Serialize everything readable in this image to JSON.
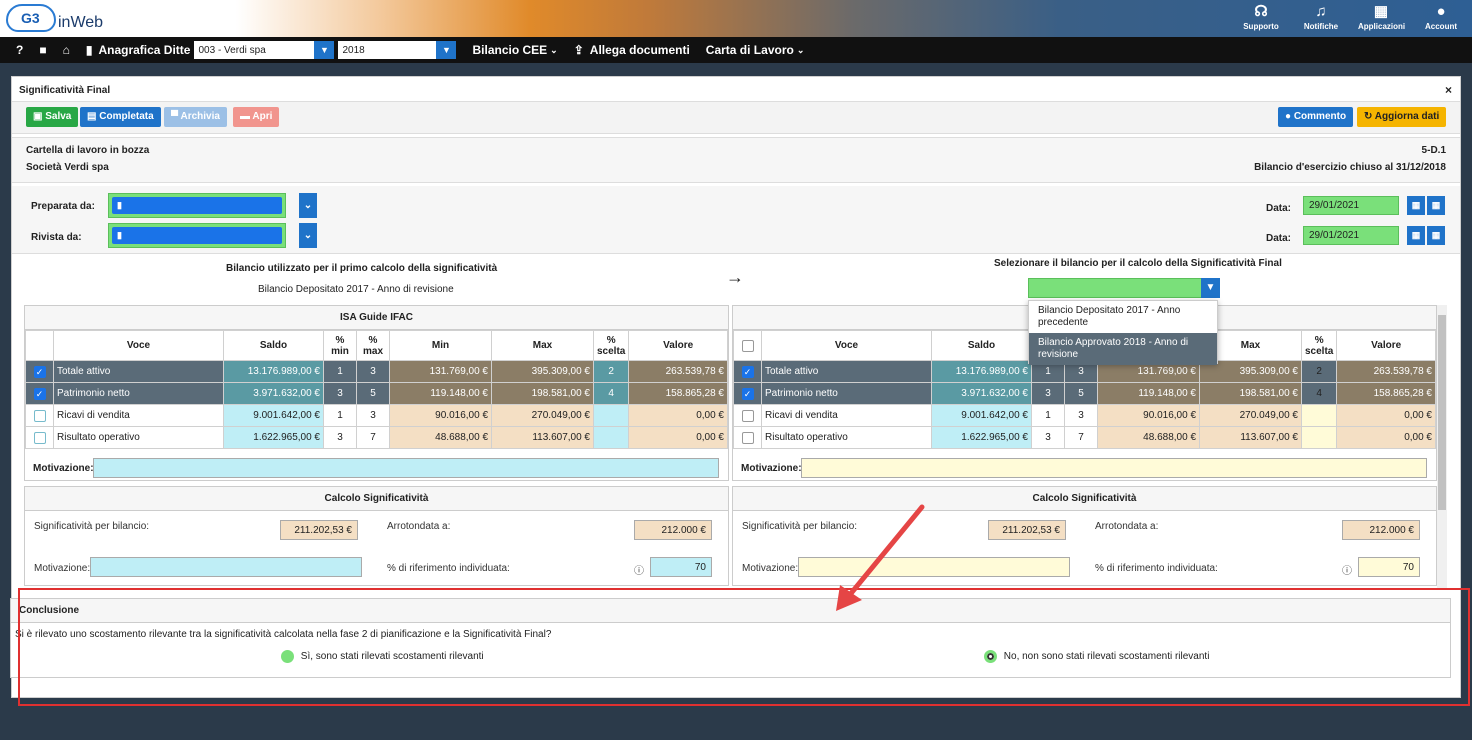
{
  "app": {
    "logo": "inWeb",
    "logo_mark": "G3"
  },
  "topbar": {
    "items": [
      {
        "label": "Supporto",
        "icon": "headset-icon",
        "glyph": "☊"
      },
      {
        "label": "Notifiche",
        "icon": "bell-icon",
        "glyph": "♫"
      },
      {
        "label": "Applicazioni",
        "icon": "grid-icon",
        "glyph": "▦"
      },
      {
        "label": "Account",
        "icon": "account-icon",
        "glyph": "●"
      }
    ]
  },
  "nav": {
    "help": "?",
    "anagrafica": "Anagrafica Ditte",
    "company": "003 - Verdi spa",
    "year": "2018",
    "bilancio": "Bilancio CEE",
    "allega": "Allega documenti",
    "carta": "Carta di Lavoro"
  },
  "panel": {
    "title": "Significatività Final",
    "close": "×"
  },
  "toolbar": {
    "salva": "Salva",
    "completata": "Completata",
    "archivia": "Archivia",
    "apri": "Apri",
    "commento": "Commento",
    "aggiorna": "Aggiorna dati"
  },
  "info": {
    "status": "Cartella di lavoro in bozza",
    "company": "Società Verdi spa",
    "code": "5-D.1",
    "bilancio": "Bilancio d'esercizio chiuso al 31/12/2018"
  },
  "prep": {
    "preparata": "Preparata da:",
    "rivista": "Rivista da:",
    "data_label": "Data:",
    "data1": "29/01/2021",
    "data2": "29/01/2021"
  },
  "left": {
    "heading": "Bilancio utilizzato per il primo calcolo della significatività",
    "sub": "Bilancio Depositato 2017  - Anno di revisione",
    "table_title": "ISA Guide IFAC"
  },
  "right": {
    "heading": "Selezionare il bilancio per il calcolo della Significatività Final",
    "options": [
      "Bilancio Depositato 2017 - Anno precedente",
      "Bilancio Approvato 2018 - Anno di revisione"
    ]
  },
  "cols": {
    "voce": "Voce",
    "saldo": "Saldo",
    "pmin": "% min",
    "pmax": "% max",
    "min": "Min",
    "max": "Max",
    "pscelta": "% scelta",
    "valore": "Valore"
  },
  "rows": [
    {
      "voce": "Totale attivo",
      "saldo": "13.176.989,00 €",
      "pmin": "1",
      "pmax": "3",
      "min": "131.769,00 €",
      "max": "395.309,00 €",
      "scelta": "2",
      "valore": "263.539,78 €"
    },
    {
      "voce": "Patrimonio netto",
      "saldo": "3.971.632,00 €",
      "pmin": "3",
      "pmax": "5",
      "min": "119.148,00 €",
      "max": "198.581,00 €",
      "scelta": "4",
      "valore": "158.865,28 €"
    },
    {
      "voce": "Ricavi di vendita",
      "saldo": "9.001.642,00 €",
      "pmin": "1",
      "pmax": "3",
      "min": "90.016,00 €",
      "max": "270.049,00 €",
      "scelta": "",
      "valore": "0,00 €"
    },
    {
      "voce": "Risultato operativo",
      "saldo": "1.622.965,00 €",
      "pmin": "3",
      "pmax": "7",
      "min": "48.688,00 €",
      "max": "113.607,00 €",
      "scelta": "",
      "valore": "0,00 €"
    }
  ],
  "motivazione": "Motivazione:",
  "calc": {
    "title": "Calcolo Significatività",
    "sig": "Significatività per bilancio:",
    "sig_val": "211.202,53 €",
    "arr": "Arrotondata a:",
    "arr_val": "212.000 €",
    "mot": "Motivazione:",
    "perc": "% di riferimento individuata:",
    "perc_val": "70"
  },
  "conclusione": {
    "title": "Conclusione",
    "question": "Si è rilevato uno scostamento rilevante tra la significatività calcolata nella fase 2 di pianificazione e la Significatività Final?",
    "yes": "Sì, sono stati rilevati scostamenti rilevanti",
    "no": "No, non sono stati rilevati scostamenti rilevanti"
  }
}
